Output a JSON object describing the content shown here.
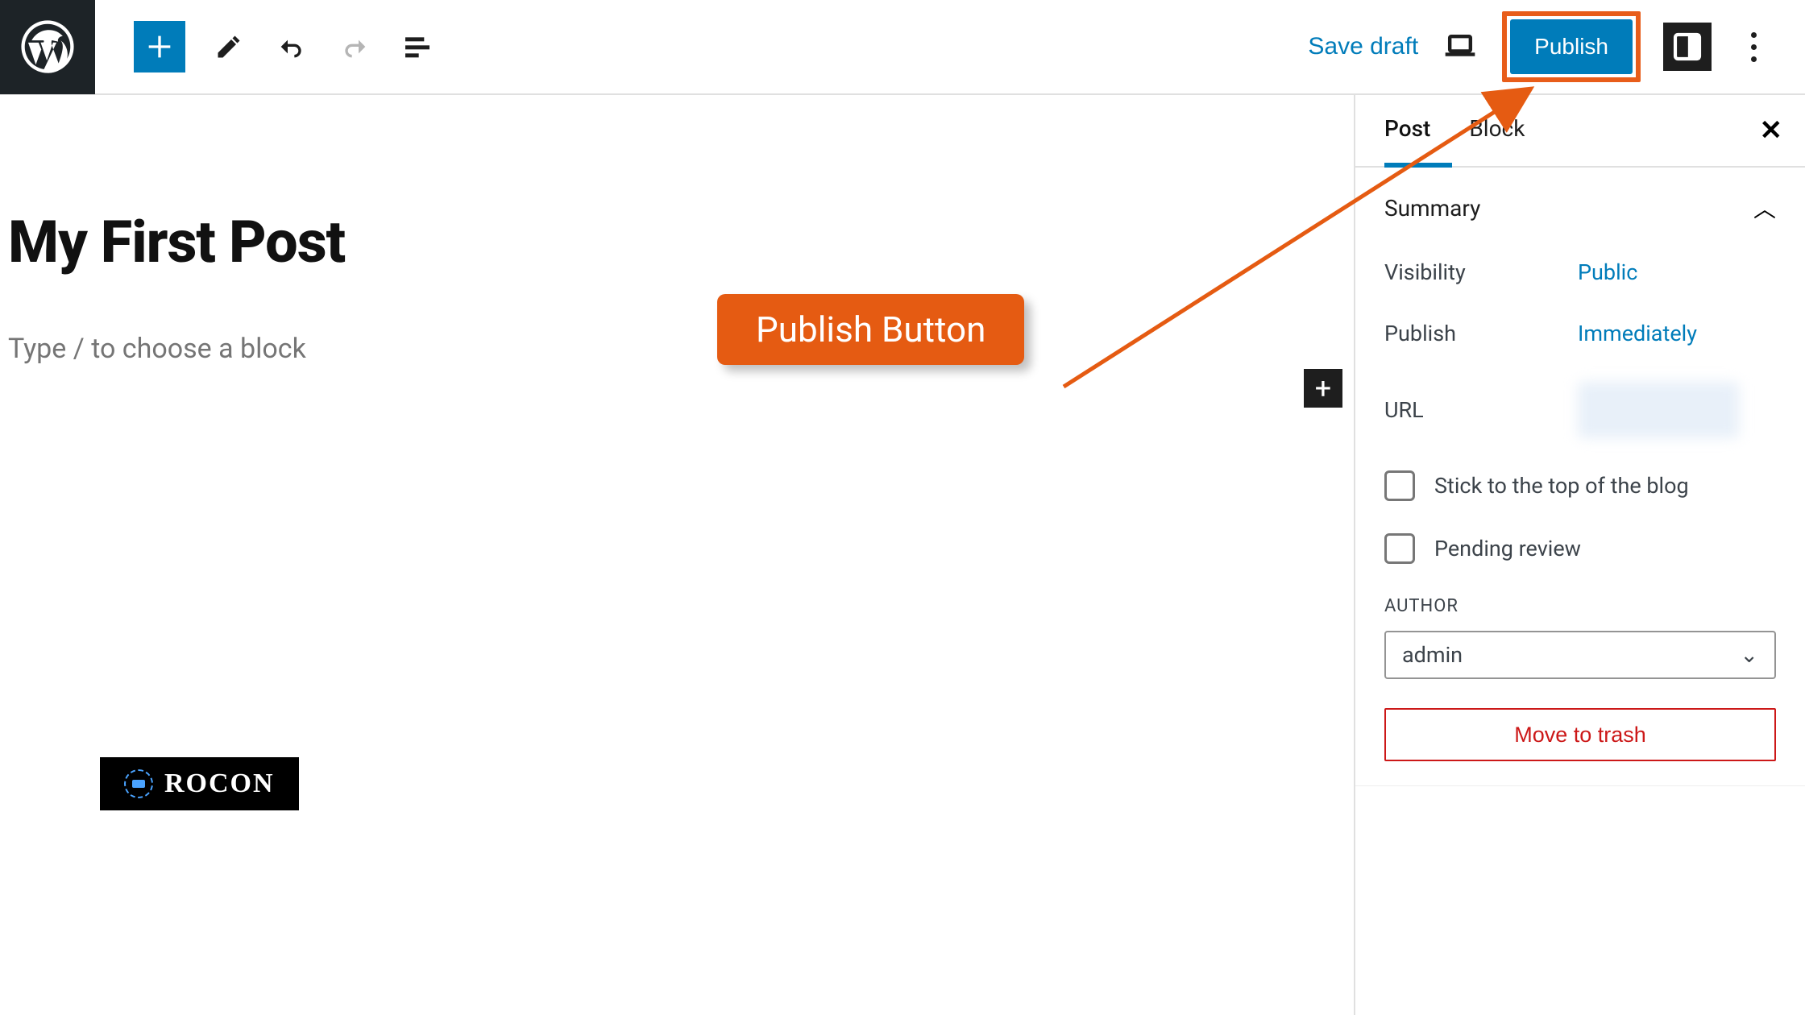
{
  "toolbar": {
    "save_draft": "Save draft",
    "publish": "Publish"
  },
  "editor": {
    "title": "My First Post",
    "placeholder": "Type / to choose a block"
  },
  "sidepanel": {
    "tabs": {
      "post": "Post",
      "block": "Block"
    },
    "summary": {
      "heading": "Summary",
      "visibility_label": "Visibility",
      "visibility_value": "Public",
      "publish_label": "Publish",
      "publish_value": "Immediately",
      "url_label": "URL",
      "stick_label": "Stick to the top of the blog",
      "pending_label": "Pending review",
      "author_heading": "AUTHOR",
      "author_value": "admin",
      "trash": "Move to trash"
    }
  },
  "annotation": {
    "callout": "Publish Button"
  },
  "badge": {
    "text": "ROCON"
  }
}
